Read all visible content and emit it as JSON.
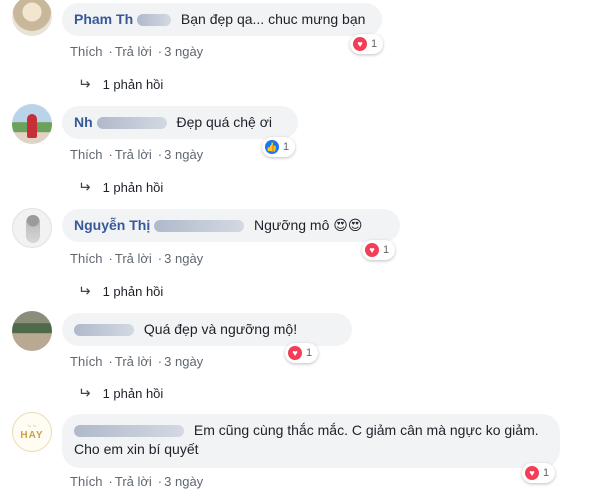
{
  "actions": {
    "like": "Thích",
    "reply": "Trả lời"
  },
  "comments": [
    {
      "author": "Pham Th",
      "text": "Bạn đẹp qa... chuc mưng bạn",
      "time": "3 ngày",
      "reaction": {
        "type": "love",
        "count": "1"
      },
      "replies": "1 phản hồi"
    },
    {
      "author": "Nh",
      "text": "Đẹp quá chệ ơi",
      "time": "3 ngày",
      "reaction": {
        "type": "like",
        "count": "1"
      },
      "replies": "1 phản hồi"
    },
    {
      "author": "Nguyễn Thị",
      "text": "Ngưỡng mô",
      "emoji": "😍😍",
      "time": "3 ngày",
      "reaction": {
        "type": "love",
        "count": "1"
      },
      "replies": "1 phản hồi"
    },
    {
      "author": "",
      "text": "Quá đẹp và ngưỡng mộ!",
      "time": "3 ngày",
      "reaction": {
        "type": "love",
        "count": "1"
      },
      "replies": "1 phản hồi"
    },
    {
      "author": "",
      "text": "Em cũng cùng thắc mắc. C giảm cân mà ngực ko giảm. Cho em xin bí quyết",
      "time": "3 ngày",
      "reaction": {
        "type": "love",
        "count": "1"
      }
    }
  ],
  "avatar5": {
    "logo": "HAY"
  }
}
